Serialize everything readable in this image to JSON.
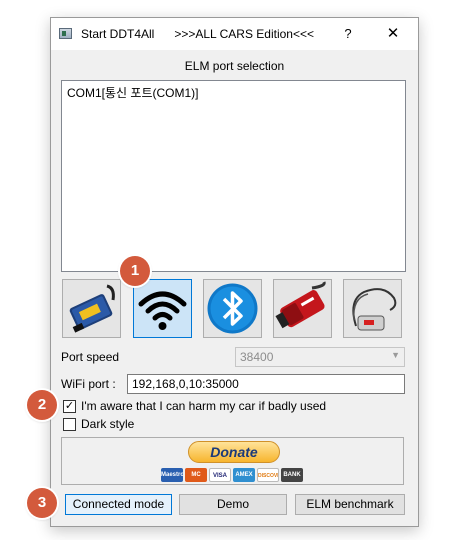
{
  "window": {
    "title": "Start DDT4All      >>>ALL CARS Edition<<<",
    "help_label": "?",
    "close_label": "✕"
  },
  "elm": {
    "section_label": "ELM port selection",
    "ports": [
      "COM1[통신 포트(COM1)]"
    ]
  },
  "devices": [
    {
      "name": "usb-elm-adapter",
      "icon": "obd-usb-adapter-icon",
      "selected": false
    },
    {
      "name": "wifi",
      "icon": "wifi-icon",
      "selected": true
    },
    {
      "name": "bluetooth",
      "icon": "bluetooth-icon",
      "selected": false
    },
    {
      "name": "obdlink",
      "icon": "obd-connector-icon",
      "selected": false
    },
    {
      "name": "cable",
      "icon": "cable-icon",
      "selected": false
    }
  ],
  "port_speed": {
    "label": "Port speed",
    "value": "38400"
  },
  "wifi_port": {
    "label": "WiFi port :",
    "value": "192,168,0,10:35000"
  },
  "aware": {
    "label": "I'm aware that I can harm my car if badly used",
    "checked": true
  },
  "dark_style": {
    "label": "Dark style",
    "checked": false
  },
  "donate": {
    "button_label": "Donate",
    "cards": [
      "Maestro",
      "MC",
      "VISA",
      "AMEX",
      "DISCOVER",
      "BANK"
    ]
  },
  "buttons": {
    "connected": "Connected mode",
    "demo": "Demo",
    "benchmark": "ELM benchmark"
  },
  "badges": [
    "1",
    "2",
    "3"
  ],
  "colors": {
    "accent": "#0078d7",
    "badge": "#d35a3c"
  }
}
